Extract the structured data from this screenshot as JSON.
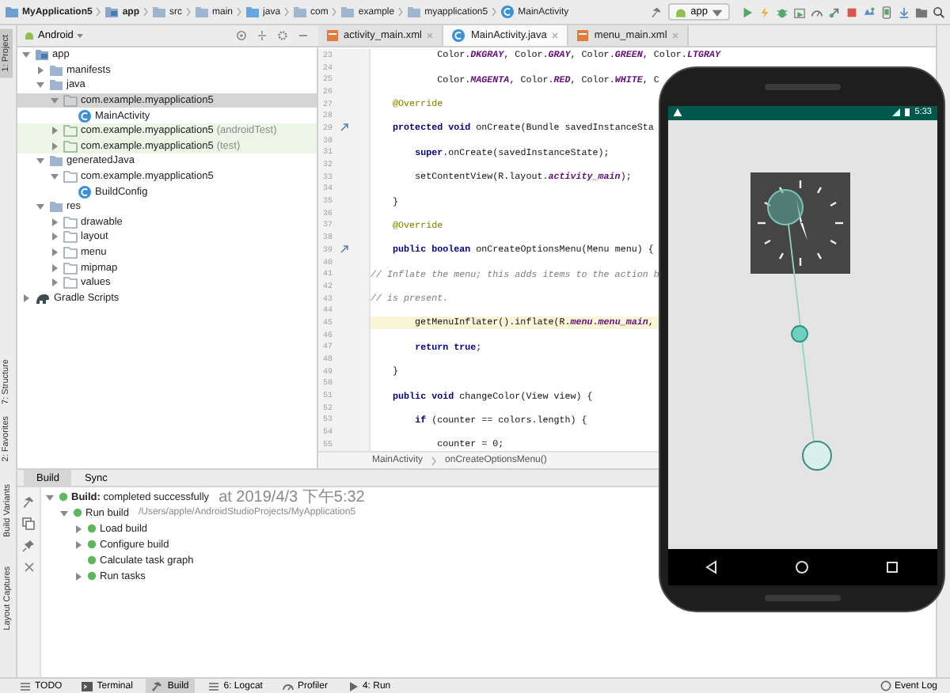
{
  "breadcrumb": [
    {
      "label": "MyApplication5",
      "kind": "project"
    },
    {
      "label": "app",
      "kind": "module"
    },
    {
      "label": "src",
      "kind": "folder"
    },
    {
      "label": "main",
      "kind": "folder"
    },
    {
      "label": "java",
      "kind": "source"
    },
    {
      "label": "com",
      "kind": "folder"
    },
    {
      "label": "example",
      "kind": "folder"
    },
    {
      "label": "myapplication5",
      "kind": "folder"
    },
    {
      "label": "MainActivity",
      "kind": "class"
    }
  ],
  "toolbar": {
    "run_config": "app"
  },
  "side_tabs": {
    "top": [
      {
        "label": "1: Project",
        "selected": true
      }
    ],
    "middle": [
      {
        "label": "7: Structure",
        "selected": false
      },
      {
        "label": "2: Favorites",
        "selected": false
      }
    ],
    "bottom": [
      {
        "label": "Build Variants",
        "selected": false
      },
      {
        "label": "Layout Captures",
        "selected": false
      }
    ]
  },
  "project_view": {
    "label": "Android"
  },
  "project_tree": [
    {
      "label": "app",
      "kind": "module",
      "expanded": true,
      "selected": false,
      "children": [
        {
          "label": "manifests",
          "kind": "folder",
          "expanded": false,
          "selected": false
        },
        {
          "label": "java",
          "kind": "folder",
          "expanded": true,
          "selected": false,
          "children": [
            {
              "label": "com.example.myapplication5",
              "kind": "package",
              "expanded": true,
              "selected": true,
              "children": [
                {
                  "label": "MainActivity",
                  "kind": "class",
                  "selected": false
                }
              ]
            },
            {
              "label": "com.example.myapplication5",
              "suffix": "(androidTest)",
              "kind": "test_package",
              "expanded": false,
              "selected": false
            },
            {
              "label": "com.example.myapplication5",
              "suffix": "(test)",
              "kind": "test_package",
              "expanded": false,
              "selected": false
            }
          ]
        },
        {
          "label": "generatedJava",
          "kind": "folder",
          "expanded": true,
          "selected": false,
          "children": [
            {
              "label": "com.example.myapplication5",
              "kind": "package",
              "expanded": true,
              "selected": false,
              "children": [
                {
                  "label": "BuildConfig",
                  "kind": "class",
                  "selected": false
                }
              ]
            }
          ]
        },
        {
          "label": "res",
          "kind": "folder",
          "expanded": true,
          "selected": false,
          "children": [
            {
              "label": "drawable",
              "kind": "package",
              "expanded": false,
              "selected": false
            },
            {
              "label": "layout",
              "kind": "package",
              "expanded": false,
              "selected": false
            },
            {
              "label": "menu",
              "kind": "package",
              "expanded": false,
              "selected": false
            },
            {
              "label": "mipmap",
              "kind": "package",
              "expanded": false,
              "selected": false
            },
            {
              "label": "values",
              "kind": "package",
              "expanded": false,
              "selected": false
            }
          ]
        }
      ]
    },
    {
      "label": "Gradle Scripts",
      "kind": "gradle",
      "expanded": false,
      "selected": false
    }
  ],
  "editor_tabs": [
    {
      "label": "activity_main.xml",
      "kind": "xml",
      "selected": false
    },
    {
      "label": "MainActivity.java",
      "kind": "java",
      "selected": true
    },
    {
      "label": "menu_main.xml",
      "kind": "xml",
      "selected": false
    }
  ],
  "code_lines": [
    {
      "number": "23",
      "current": false,
      "kind": "code",
      "text": "            Color.*DKGRAY*, Color.*GRAY*, Color.*GREEN*, Color.*LTGRAY*"
    },
    {
      "number": "24",
      "current": false
    },
    {
      "number": "25",
      "current": false,
      "kind": "code",
      "text": "            Color.*MAGENTA*, Color.*RED*, Color.*WHITE*, C"
    },
    {
      "number": "26",
      "current": false
    },
    {
      "number": "27",
      "current": false,
      "kind": "annotation",
      "text": "    @Override"
    },
    {
      "number": "28",
      "current": false
    },
    {
      "number": "29",
      "current": false,
      "override": true,
      "kind": "code",
      "text": "    **protected void** onCreate(Bundle savedInstanceSta"
    },
    {
      "number": "30",
      "current": false
    },
    {
      "number": "31",
      "current": false,
      "kind": "code",
      "text": "        **super**.onCreate(savedInstanceState);"
    },
    {
      "number": "32",
      "current": false
    },
    {
      "number": "33",
      "current": false,
      "kind": "code",
      "text": "        setContentView(R.layout.*activity_main*);"
    },
    {
      "number": "34",
      "current": false
    },
    {
      "number": "35",
      "current": false,
      "kind": "code",
      "text": "    }"
    },
    {
      "number": "36",
      "current": false
    },
    {
      "number": "37",
      "current": false,
      "kind": "annotation",
      "text": "    @Override"
    },
    {
      "number": "38",
      "current": false
    },
    {
      "number": "39",
      "current": false,
      "override": true,
      "kind": "code",
      "text": "    **public boolean** onCreateOptionsMenu(Menu menu) {"
    },
    {
      "number": "40",
      "current": false
    },
    {
      "number": "41",
      "current": false,
      "kind": "comment",
      "text": "// Inflate the menu; this adds items to the action b"
    },
    {
      "number": "42",
      "current": false
    },
    {
      "number": "43",
      "current": false,
      "kind": "comment",
      "text": "// is present."
    },
    {
      "number": "44",
      "current": false
    },
    {
      "number": "45",
      "current": true,
      "kind": "code",
      "text": "        getMenuInflater().inflate(R.*menu*.*menu_main*,"
    },
    {
      "number": "46",
      "current": false
    },
    {
      "number": "47",
      "current": false,
      "kind": "code",
      "text": "        **return true**;"
    },
    {
      "number": "48",
      "current": false
    },
    {
      "number": "49",
      "current": false,
      "kind": "code",
      "text": "    }"
    },
    {
      "number": "50",
      "current": false
    },
    {
      "number": "51",
      "current": false,
      "kind": "code",
      "text": "    **public void** changeColor(View view) {"
    },
    {
      "number": "52",
      "current": false
    },
    {
      "number": "53",
      "current": false,
      "kind": "code",
      "text": "        **if** (counter == colors.length) {"
    },
    {
      "number": "54",
      "current": false
    },
    {
      "number": "55",
      "current": false,
      "kind": "code",
      "text": "            counter = 0;"
    }
  ],
  "editor_breadcrumb": [
    "MainActivity",
    "onCreateOptionsMenu()"
  ],
  "build_panel": {
    "tabs": [
      {
        "label": "Build",
        "selected": true
      },
      {
        "label": "Sync",
        "selected": false
      }
    ],
    "tree": [
      {
        "title": "**Build:** completed successfully",
        "detail": "at 2019/4/3 下午5:32",
        "expanded": true,
        "children": [
          {
            "title": "Run build",
            "detail": "/Users/apple/AndroidStudioProjects/MyApplication5",
            "expanded": true,
            "children": [
              {
                "title": "Load build",
                "expanded": false
              },
              {
                "title": "Configure build",
                "expanded": false
              },
              {
                "title": "Calculate task graph"
              },
              {
                "title": "Run tasks",
                "expanded": false
              }
            ]
          }
        ]
      }
    ]
  },
  "bottom_tabs": [
    {
      "label": "TODO",
      "kind": "list",
      "selected": false
    },
    {
      "label": "Terminal",
      "kind": "terminal",
      "selected": false
    },
    {
      "label": "Build",
      "kind": "build",
      "selected": true
    },
    {
      "label": "6: Logcat",
      "kind": "list",
      "selected": false
    },
    {
      "label": "Profiler",
      "kind": "gauge",
      "selected": false
    },
    {
      "label": "4: Run",
      "kind": "run",
      "selected": false
    }
  ],
  "event_log": "Event Log",
  "emulator": {
    "time": "5:33"
  }
}
